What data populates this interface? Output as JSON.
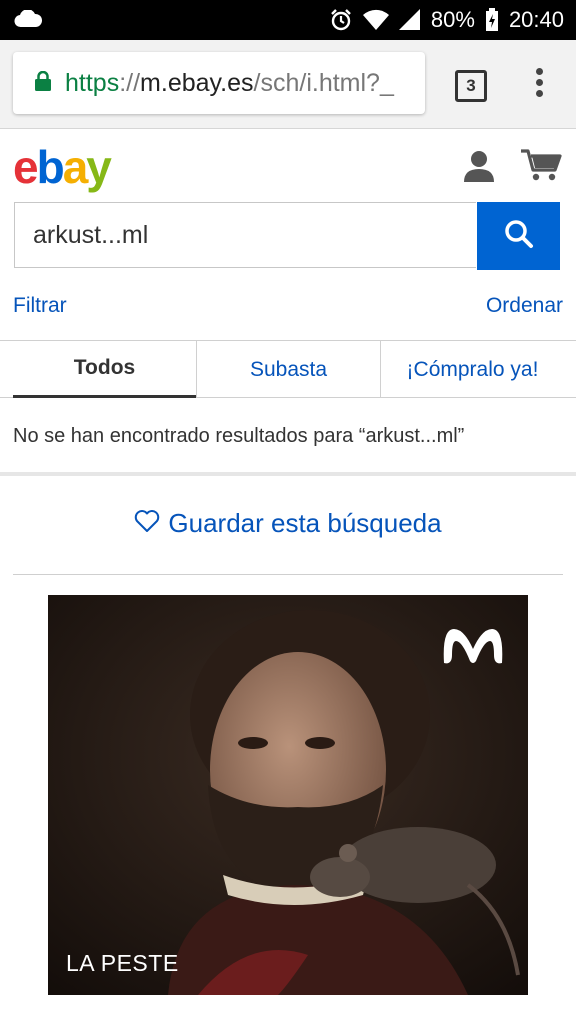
{
  "status_bar": {
    "battery": "80%",
    "time": "20:40"
  },
  "browser": {
    "url_scheme": "https",
    "url_sep": "://",
    "url_host": "m.ebay.es",
    "url_path": "/sch/i.html?_",
    "tab_count": "3"
  },
  "header": {
    "logo_letters": [
      "e",
      "b",
      "a",
      "y"
    ]
  },
  "search": {
    "value": "arkust...ml"
  },
  "controls": {
    "filter_label": "Filtrar",
    "sort_label": "Ordenar"
  },
  "tabs": [
    {
      "label": "Todos",
      "active": true
    },
    {
      "label": "Subasta",
      "active": false
    },
    {
      "label": "¡Cómpralo ya!",
      "active": false
    }
  ],
  "results": {
    "message": "No se han encontrado resultados para “arkust...ml”"
  },
  "save_search": {
    "label": "Guardar esta búsqueda"
  },
  "ad": {
    "caption": "LA PESTE",
    "brand_icon": "movistar-m-logo"
  },
  "colors": {
    "ebay_blue": "#0064d2",
    "link_blue": "#0654ba",
    "secure_green": "#0b8043"
  }
}
